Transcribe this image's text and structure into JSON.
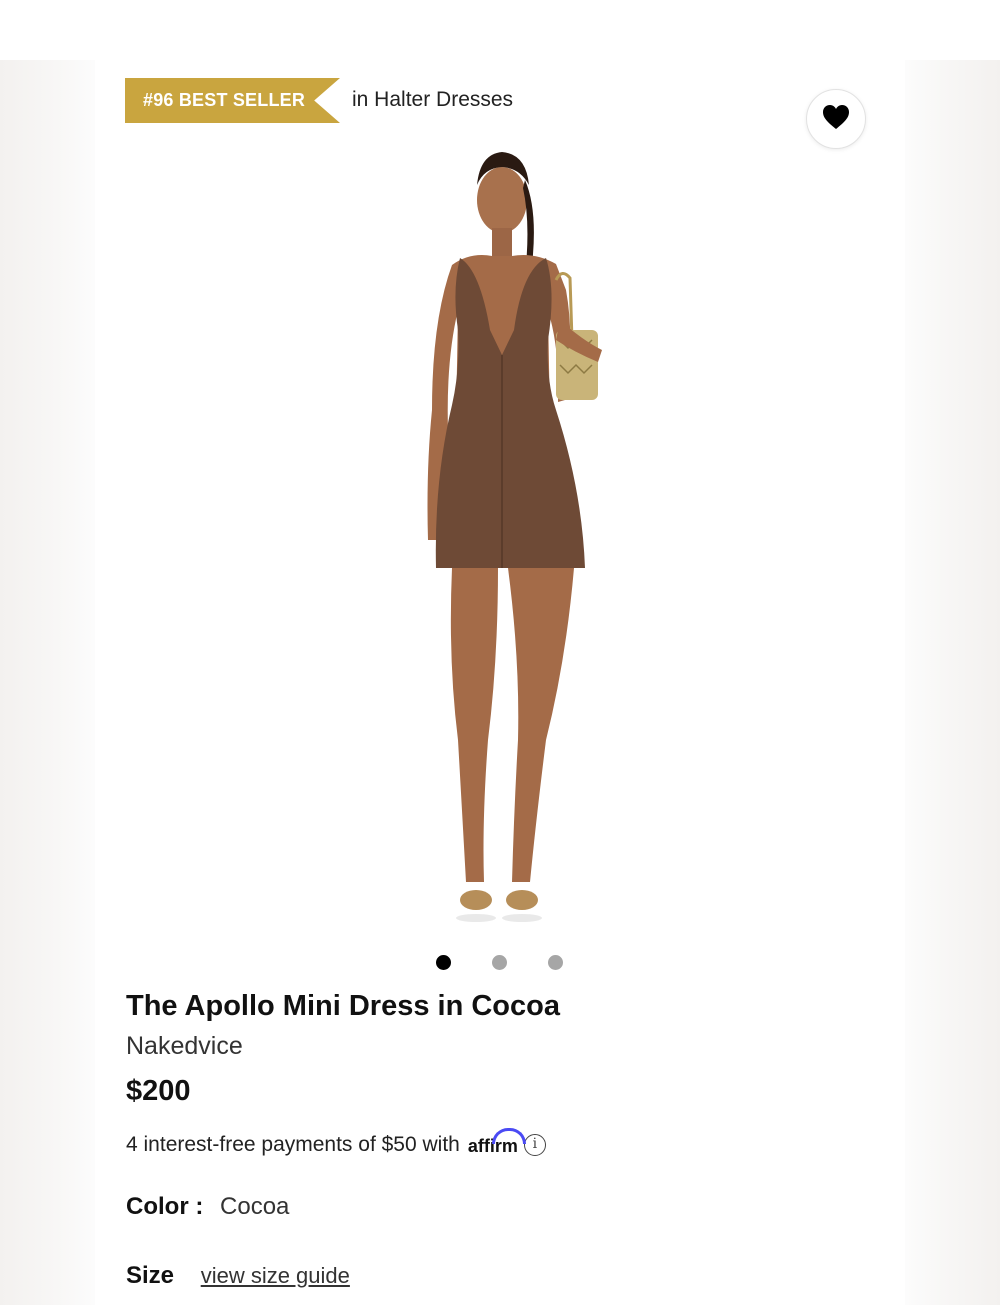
{
  "badge": {
    "label": "#96 BEST SELLER",
    "context": "in Halter Dresses",
    "color": "#c9a53f"
  },
  "favorite": {
    "icon": "heart-icon"
  },
  "carousel": {
    "image_count": 3,
    "active_index": 0
  },
  "product": {
    "title": "The Apollo Mini Dress in Cocoa",
    "brand": "Nakedvice",
    "price": "$200",
    "payments_text": "4 interest-free payments of $50 with",
    "payments_provider": "affirm",
    "info_icon": "info-icon",
    "color_label": "Color",
    "color_value": "Cocoa",
    "size_label": "Size",
    "size_guide_link": "view size guide"
  }
}
